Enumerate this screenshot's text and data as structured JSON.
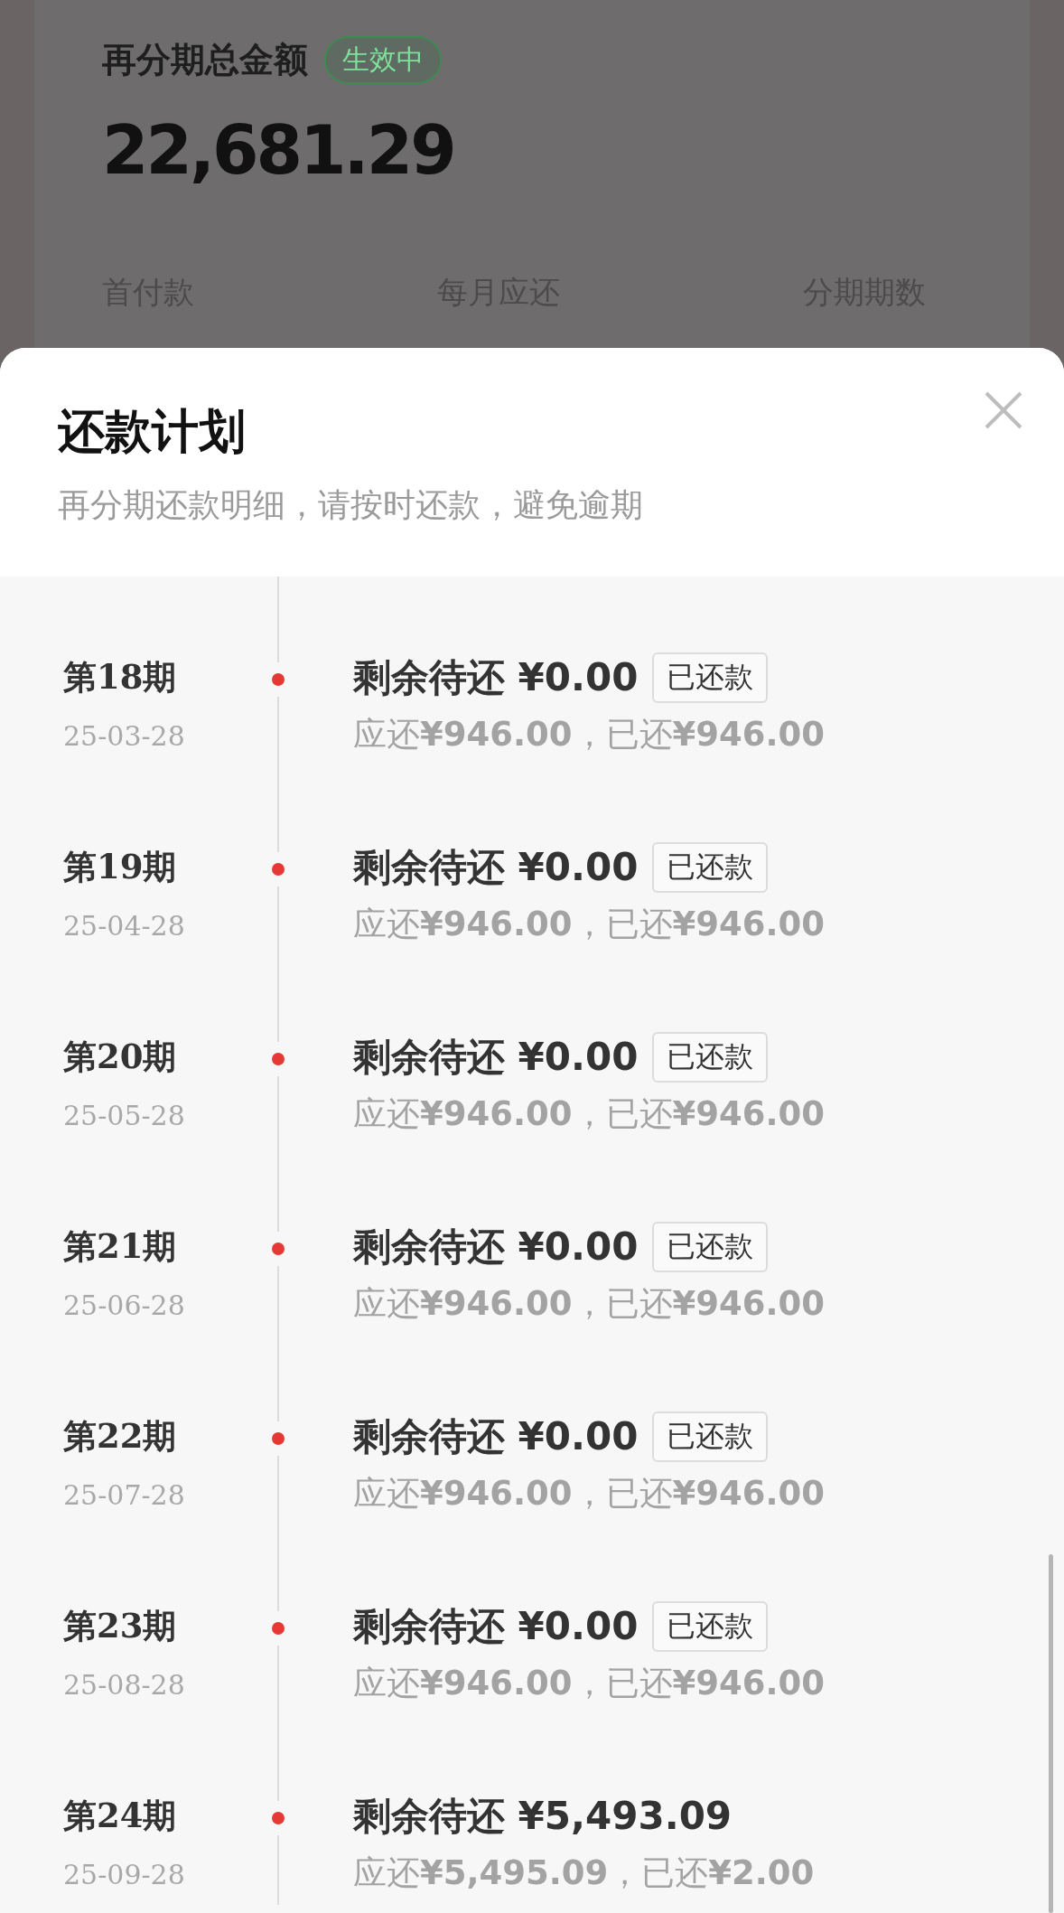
{
  "summary": {
    "title": "再分期总金额",
    "status_badge": "生效中",
    "total_amount": "22,681.29",
    "labels": [
      "首付款",
      "每月应还",
      "分期期数"
    ]
  },
  "sheet": {
    "title": "还款计划",
    "subtitle": "再分期还款明细，请按时还款，避免逾期"
  },
  "installments": [
    {
      "period": "第18期",
      "date": "25-03-28",
      "remaining": "剩余待还 ¥0.00",
      "tag": "已还款",
      "detail": "应还**¥946.00**，已还**¥946.00**"
    },
    {
      "period": "第19期",
      "date": "25-04-28",
      "remaining": "剩余待还 ¥0.00",
      "tag": "已还款",
      "detail": "应还**¥946.00**，已还**¥946.00**"
    },
    {
      "period": "第20期",
      "date": "25-05-28",
      "remaining": "剩余待还 ¥0.00",
      "tag": "已还款",
      "detail": "应还**¥946.00**，已还**¥946.00**"
    },
    {
      "period": "第21期",
      "date": "25-06-28",
      "remaining": "剩余待还 ¥0.00",
      "tag": "已还款",
      "detail": "应还**¥946.00**，已还**¥946.00**"
    },
    {
      "period": "第22期",
      "date": "25-07-28",
      "remaining": "剩余待还 ¥0.00",
      "tag": "已还款",
      "detail": "应还**¥946.00**，已还**¥946.00**"
    },
    {
      "period": "第23期",
      "date": "25-08-28",
      "remaining": "剩余待还 ¥0.00",
      "tag": "已还款",
      "detail": "应还**¥946.00**，已还**¥946.00**"
    },
    {
      "period": "第24期",
      "date": "25-09-28",
      "remaining": "剩余待还 ¥5,493.09",
      "detail": "应还**¥5,495.09**，已还**¥2.00**"
    }
  ]
}
